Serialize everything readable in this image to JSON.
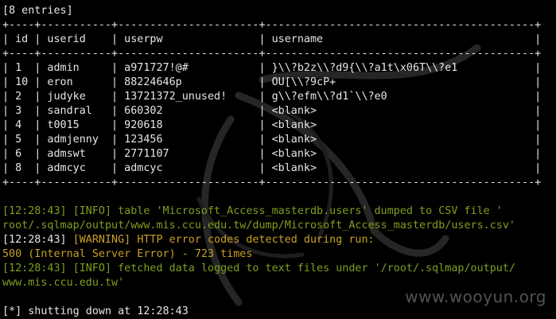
{
  "header": "[8 entries]",
  "border": "+----+-----------+----------------------+------------------------------------------+",
  "columns": [
    "id",
    "userid",
    "userpw",
    "username"
  ],
  "rows": [
    {
      "id": "1",
      "userid": "admin",
      "userpw": "a971727!@#",
      "username": "}\\\\?b2z\\\\?d9{\\\\?a1t\\x06T\\\\?e1"
    },
    {
      "id": "10",
      "userid": "eron",
      "userpw": "88224646p",
      "username": "OU[\\\\?9cP+"
    },
    {
      "id": "2",
      "userid": "judyke",
      "userpw": "13721372_unused!",
      "username": "g\\\\?efm\\\\?d1`\\\\?e0"
    },
    {
      "id": "3",
      "userid": "sandral",
      "userpw": "660302",
      "username": "<blank>"
    },
    {
      "id": "4",
      "userid": "t0015",
      "userpw": "920618",
      "username": "<blank>"
    },
    {
      "id": "5",
      "userid": "admjenny",
      "userpw": "123456",
      "username": "<blank>"
    },
    {
      "id": "6",
      "userid": "admswt",
      "userpw": "2771107",
      "username": "<blank>"
    },
    {
      "id": "8",
      "userid": "admcyc",
      "userpw": "admcyc",
      "username": "<blank>"
    }
  ],
  "log": [
    {
      "time": "[12:28:43]",
      "level": "[INFO]",
      "msg": "table 'Microsoft_Access_masterdb.users' dumped to CSV file '",
      "level_color": "#7f9f1f"
    },
    {
      "cont": "root/.sqlmap/output/www.mis.ccu.edu.tw/dump/Microsoft_Access_masterdb/users.csv'"
    },
    {
      "time": "[12:28:43]",
      "level": "[WARNING]",
      "msg": "HTTP error codes detected during run:",
      "level_color": "#c8a026"
    },
    {
      "cont": "500 (Internal Server Error) - 723 times"
    },
    {
      "time": "[12:28:43]",
      "level": "[INFO]",
      "msg": "fetched data logged to text files under '/root/.sqlmap/output/",
      "level_color": "#7f9f1f"
    },
    {
      "cont": "www.mis.ccu.edu.tw'"
    }
  ],
  "shutdown": "[*] shutting down at 12:28:43",
  "watermark": "www.wooyun.org",
  "colors": {
    "background": "#000000",
    "text": "#e6e6e6",
    "info_green": "#7f9f1f",
    "warning_orange": "#c8a026",
    "dragon_art": "#2a2a2a"
  }
}
